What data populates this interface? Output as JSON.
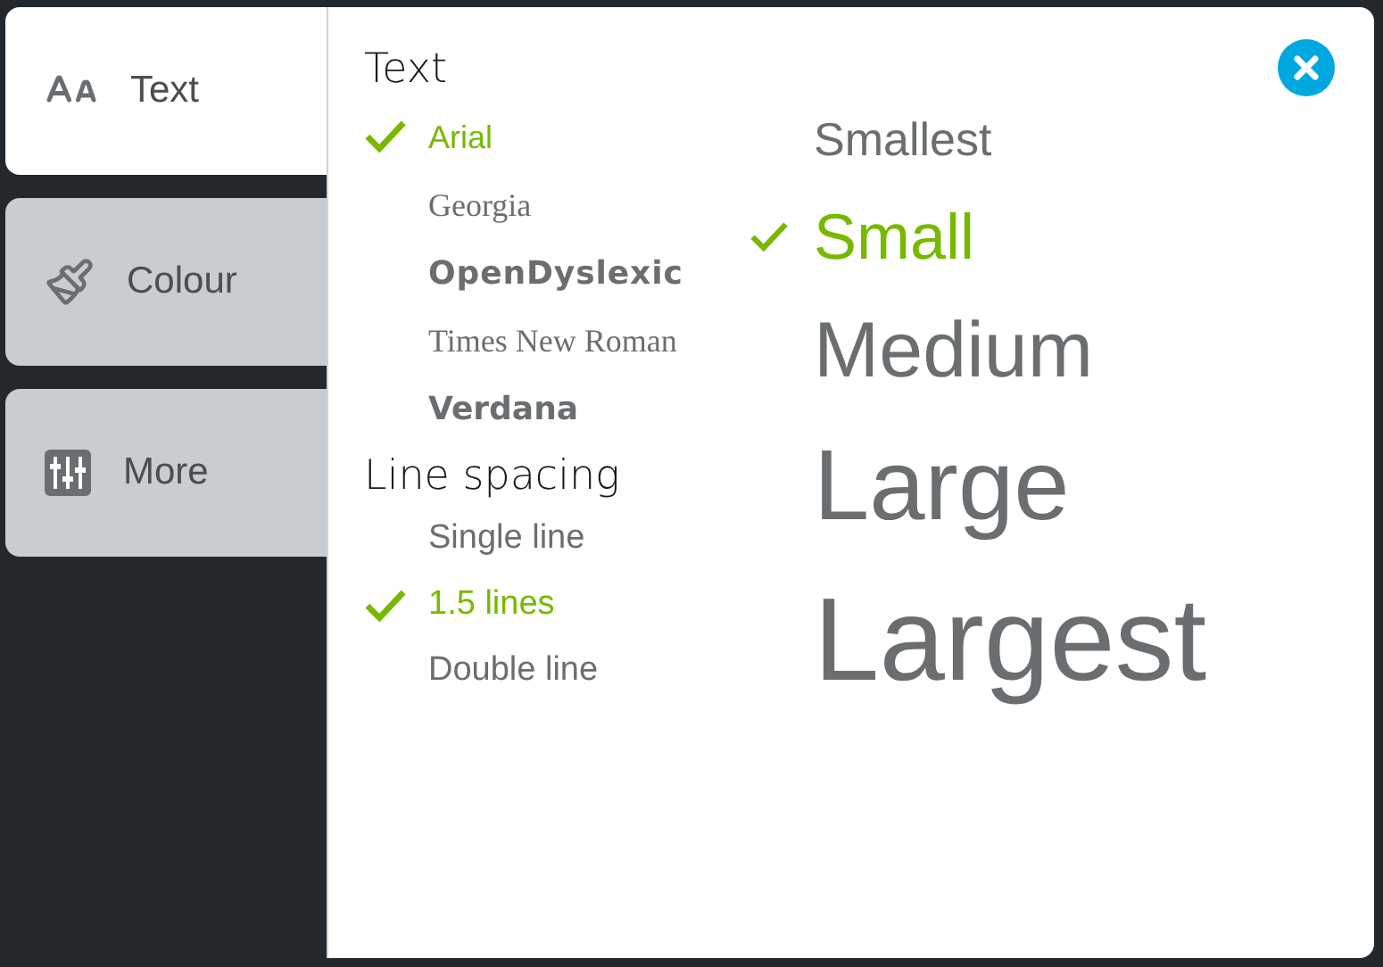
{
  "tabs": [
    {
      "label": "Text",
      "selected": true
    },
    {
      "label": "Colour",
      "selected": false
    },
    {
      "label": "More",
      "selected": false
    }
  ],
  "text_panel": {
    "title": "Text",
    "fonts": [
      {
        "label": "Arial",
        "selected": true
      },
      {
        "label": "Georgia",
        "selected": false
      },
      {
        "label": "OpenDyslexic",
        "selected": false
      },
      {
        "label": "Times New Roman",
        "selected": false
      },
      {
        "label": "Verdana",
        "selected": false
      }
    ],
    "line_spacing_title": "Line spacing",
    "line_spacing": [
      {
        "label": "Single line",
        "selected": false
      },
      {
        "label": "1.5 lines",
        "selected": true
      },
      {
        "label": "Double line",
        "selected": false
      }
    ],
    "sizes": [
      {
        "label": "Smallest",
        "selected": false
      },
      {
        "label": "Small",
        "selected": true
      },
      {
        "label": "Medium",
        "selected": false
      },
      {
        "label": "Large",
        "selected": false
      },
      {
        "label": "Largest",
        "selected": false
      }
    ]
  }
}
